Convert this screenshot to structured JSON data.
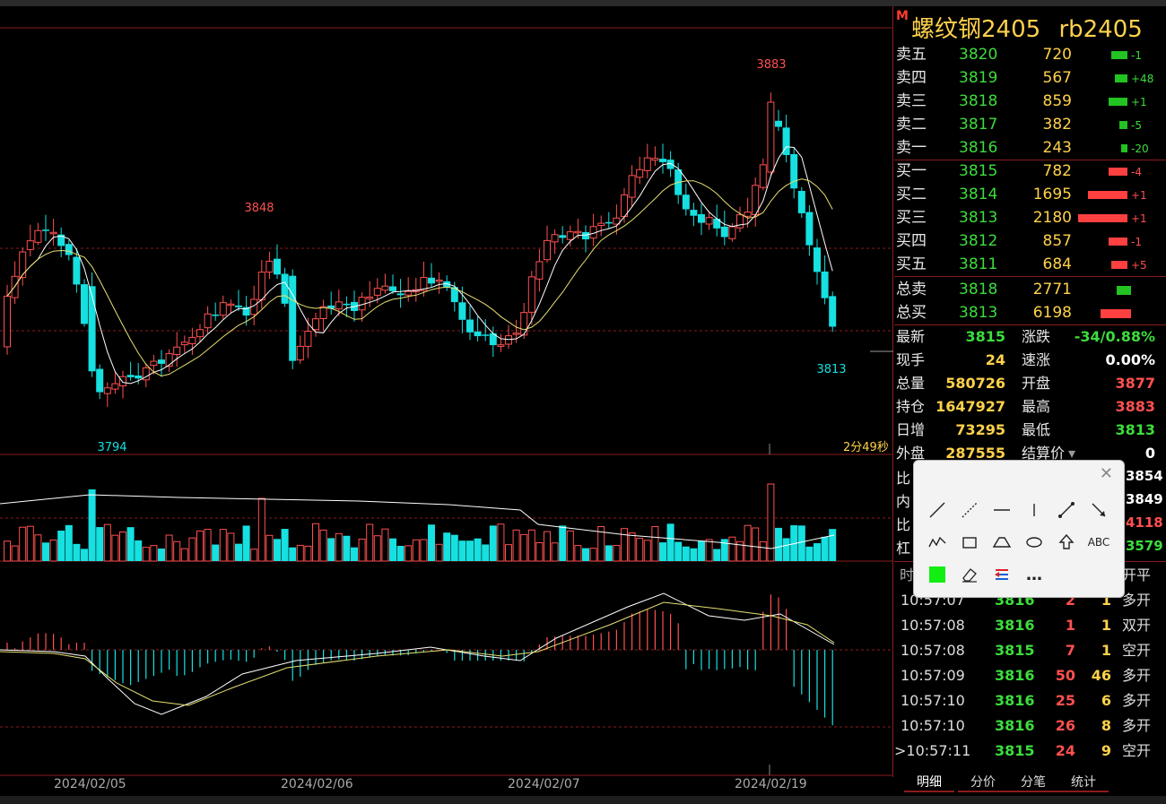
{
  "instrument": {
    "name": "螺纹钢2405",
    "code": "rb2405",
    "marker": "M"
  },
  "order_book": {
    "asks": [
      {
        "label": "卖五",
        "price": "3820",
        "volume": "720",
        "change": "-1",
        "bar": 0.08
      },
      {
        "label": "卖四",
        "price": "3819",
        "volume": "567",
        "change": "+48",
        "bar": 0.06
      },
      {
        "label": "卖三",
        "price": "3818",
        "volume": "859",
        "change": "+1",
        "bar": 0.09
      },
      {
        "label": "卖二",
        "price": "3817",
        "volume": "382",
        "change": "-5",
        "bar": 0.04
      },
      {
        "label": "卖一",
        "price": "3816",
        "volume": "243",
        "change": "-20",
        "bar": 0.03
      }
    ],
    "bids": [
      {
        "label": "买一",
        "price": "3815",
        "volume": "782",
        "change": "-4",
        "bar": 0.09
      },
      {
        "label": "买二",
        "price": "3814",
        "volume": "1695",
        "change": "+1",
        "bar": 0.19
      },
      {
        "label": "买三",
        "price": "3813",
        "volume": "2180",
        "change": "+1",
        "bar": 0.24
      },
      {
        "label": "买四",
        "price": "3812",
        "volume": "857",
        "change": "-1",
        "bar": 0.09
      },
      {
        "label": "买五",
        "price": "3811",
        "volume": "684",
        "change": "+5",
        "bar": 0.08
      }
    ],
    "total_sell": {
      "label": "总卖",
      "price": "3818",
      "volume": "2771"
    },
    "total_buy": {
      "label": "总买",
      "price": "3813",
      "volume": "6198"
    }
  },
  "quote": {
    "left": [
      {
        "label": "最新",
        "value": "3815",
        "color": "#3ddc3d"
      },
      {
        "label": "现手",
        "value": "24",
        "color": "#ffd24a"
      },
      {
        "label": "总量",
        "value": "580726",
        "color": "#ffd24a"
      },
      {
        "label": "持仓",
        "value": "1647927",
        "color": "#ffd24a"
      },
      {
        "label": "日增",
        "value": "73295",
        "color": "#ffd24a"
      },
      {
        "label": "外盘",
        "value": "287555",
        "color": "#ffd24a"
      }
    ],
    "right": [
      {
        "label": "涨跌",
        "value": "-34/0.88%",
        "color": "#3ddc3d"
      },
      {
        "label": "速涨",
        "value": "0.00%",
        "color": "#ffffff"
      },
      {
        "label": "开盘",
        "value": "3877",
        "color": "#ff5050"
      },
      {
        "label": "最高",
        "value": "3883",
        "color": "#ff5050"
      },
      {
        "label": "最低",
        "value": "3813",
        "color": "#3ddc3d"
      },
      {
        "label": "结算价",
        "value": "0",
        "color": "#ffffff"
      }
    ],
    "partial_labels": [
      "比",
      "内",
      "比",
      "杠"
    ],
    "partial_values": [
      {
        "value": "3854",
        "color": "#ffffff"
      },
      {
        "value": "3849",
        "color": "#ffffff"
      },
      {
        "value": "4118",
        "color": "#ff5050"
      },
      {
        "value": "3579",
        "color": "#3ddc3d"
      }
    ]
  },
  "ticks_header": {
    "time": "时",
    "type": "开平"
  },
  "ticks": [
    {
      "time": "10:57:07",
      "price": "3816",
      "vol": "2",
      "oi": "1",
      "type": "多开"
    },
    {
      "time": "10:57:08",
      "price": "3816",
      "vol": "1",
      "oi": "1",
      "type": "双开"
    },
    {
      "time": "10:57:08",
      "price": "3815",
      "vol": "7",
      "oi": "1",
      "type": "空开"
    },
    {
      "time": "10:57:09",
      "price": "3816",
      "vol": "50",
      "oi": "46",
      "type": "多开"
    },
    {
      "time": "10:57:10",
      "price": "3816",
      "vol": "25",
      "oi": "6",
      "type": "多开"
    },
    {
      "time": "10:57:10",
      "price": "3816",
      "vol": "26",
      "oi": "8",
      "type": "多开"
    },
    {
      "time": ">10:57:11",
      "price": "3815",
      "vol": "24",
      "oi": "9",
      "type": "空开"
    }
  ],
  "tabs": [
    "明细",
    "分价",
    "分笔",
    "统计"
  ],
  "chart": {
    "dates": [
      "2024/02/05",
      "2024/02/06",
      "2024/02/07",
      "2024/02/19"
    ],
    "countdown": "2分49秒",
    "annotations": {
      "high": "3883",
      "low": "3794",
      "peak2": "3848",
      "last": "3813"
    }
  },
  "toolbox": {
    "close": "✕",
    "tools": [
      "line-tool",
      "dashed-line-tool",
      "horizontal-line-tool",
      "vertical-line-tool",
      "segment-tool",
      "arrow-tool",
      "zigzag-tool",
      "rectangle-tool",
      "triangle-tool",
      "ellipse-tool",
      "up-arrow-tool",
      "text-tool",
      "color-tool",
      "eraser-tool",
      "align-tool",
      "more-tool"
    ],
    "text_label": "ABC",
    "more_label": "…",
    "color": "#11ee11"
  },
  "colors": {
    "up": "#ff5050",
    "down": "#16e0e0",
    "grid": "#8a1c1c",
    "ma1": "#ffffff",
    "ma2": "#e8e070"
  }
}
